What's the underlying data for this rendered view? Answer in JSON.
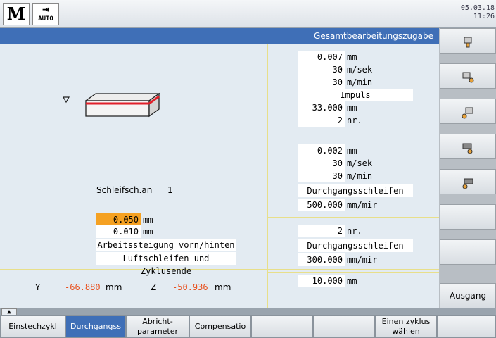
{
  "header": {
    "logo_text": "M",
    "auto_arrow": "⇥",
    "auto_label": "AUTO",
    "date": "05.03.18",
    "time": "11:26"
  },
  "title": "Gesamtbearbeitungszugabe",
  "right_group1": [
    {
      "value": "0.007",
      "unit": "mm"
    },
    {
      "value": "30",
      "unit": "m/sek"
    },
    {
      "value": "30",
      "unit": "m/min"
    },
    {
      "value": "Impuls",
      "unit": ""
    },
    {
      "value": "33.000",
      "unit": "mm"
    },
    {
      "value": "2",
      "unit": "nr."
    }
  ],
  "right_group2": [
    {
      "value": "0.002",
      "unit": "mm"
    },
    {
      "value": "30",
      "unit": "m/sek"
    },
    {
      "value": "30",
      "unit": "m/min"
    },
    {
      "value": "Durchgangsschleifen",
      "unit": ""
    },
    {
      "value": "500.000",
      "unit": "mm/mir"
    }
  ],
  "right_group3": [
    {
      "value": "2",
      "unit": "nr."
    },
    {
      "value": "Durchgangsschleifen",
      "unit": ""
    },
    {
      "value": "300.000",
      "unit": "mm/mir"
    }
  ],
  "right_group4": [
    {
      "value": "10.000",
      "unit": "mm"
    }
  ],
  "left": {
    "wheel_label": "Schleifsch.an",
    "wheel_number": "1",
    "fields": [
      {
        "value": "0.050",
        "unit": "mm"
      },
      {
        "value": "0.010",
        "unit": "mm"
      },
      {
        "value": "Arbeitssteigung vorn/hinten",
        "unit": ""
      },
      {
        "value": "Luftschleifen und Zyklusende",
        "unit": ""
      }
    ]
  },
  "position": {
    "y_label": "Y",
    "y_value": "-66.880",
    "y_unit": "mm",
    "z_label": "Z",
    "z_value": "-50.936",
    "z_unit": "mm"
  },
  "softkeys": {
    "exit_label": "Ausgang"
  },
  "bottom_tabs": [
    {
      "label": "Einstechzykl"
    },
    {
      "label": "Durchgangss"
    },
    {
      "label": "Abricht-\nparameter"
    },
    {
      "label": "Compensatio"
    },
    {
      "label": ""
    },
    {
      "label": ""
    },
    {
      "label": "Einen zyklus\nwählen"
    },
    {
      "label": ""
    }
  ],
  "colors": {
    "accent": "#3f6fb7",
    "highlight": "#f5a122",
    "position_value": "#e8501e",
    "panel": "#e3ebf2"
  }
}
